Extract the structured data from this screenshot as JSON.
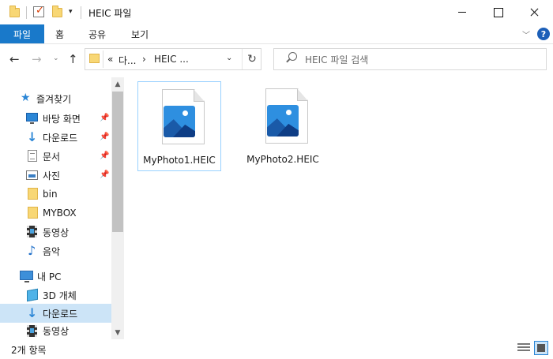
{
  "window": {
    "title": "HEIC 파일"
  },
  "ribbon": {
    "tabs": [
      "파일",
      "홈",
      "공유",
      "보기"
    ],
    "help": "?"
  },
  "address": {
    "crumbs": [
      "«",
      "다...",
      "›",
      "HEIC ..."
    ]
  },
  "search": {
    "placeholder": "HEIC 파일 검색"
  },
  "nav": {
    "items": [
      {
        "label": "즐겨찾기",
        "icon": "star-icon"
      },
      {
        "label": "바탕 화면",
        "icon": "desktop-icon",
        "pinned": true
      },
      {
        "label": "다운로드",
        "icon": "download-arrow-icon",
        "pinned": true
      },
      {
        "label": "문서",
        "icon": "document-icon",
        "pinned": true
      },
      {
        "label": "사진",
        "icon": "pictures-icon",
        "pinned": true
      },
      {
        "label": "bin",
        "icon": "folder-icon"
      },
      {
        "label": "MYBOX",
        "icon": "folder-icon"
      },
      {
        "label": "동영상",
        "icon": "video-icon"
      },
      {
        "label": "음악",
        "icon": "music-icon"
      },
      {
        "label": "내 PC",
        "icon": "this-pc-icon"
      },
      {
        "label": "3D 개체",
        "icon": "3d-objects-icon"
      },
      {
        "label": "다운로드",
        "icon": "download-arrow-icon",
        "selected": true
      },
      {
        "label": "동영상",
        "icon": "video-icon"
      }
    ]
  },
  "files": [
    {
      "name": "MyPhoto1.HEIC",
      "selected": true
    },
    {
      "name": "MyPhoto2.HEIC",
      "selected": false
    }
  ],
  "status": {
    "count": "2개 항목"
  },
  "colors": {
    "accent": "#1979ca",
    "selection": "#cce4f7",
    "folder": "#f8d775"
  }
}
